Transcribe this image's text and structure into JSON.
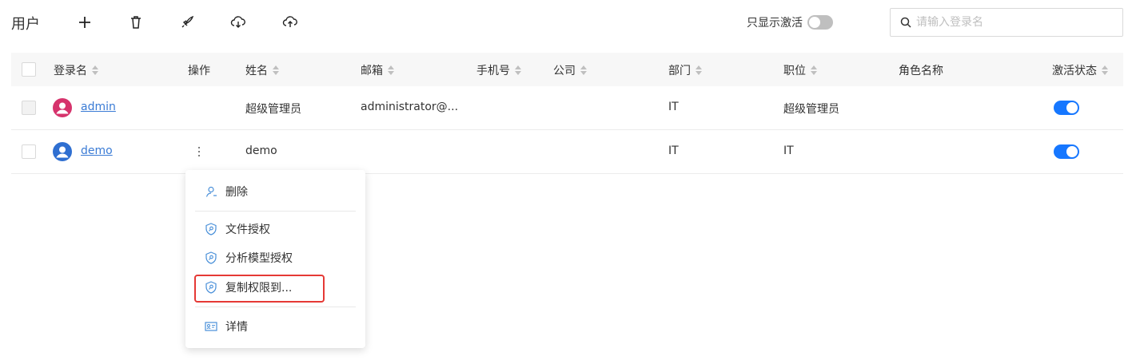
{
  "header": {
    "title": "用户",
    "icons": [
      "add-icon",
      "trash-icon",
      "rocket-icon",
      "cloud-download-icon",
      "cloud-upload-icon"
    ],
    "active_only_label": "只显示激活",
    "active_only_on": false,
    "search_placeholder": "请输入登录名"
  },
  "table": {
    "columns": {
      "login": "登录名",
      "actions": "操作",
      "name": "姓名",
      "email": "邮箱",
      "phone": "手机号",
      "company": "公司",
      "department": "部门",
      "position": "职位",
      "role": "角色名称",
      "status": "激活状态"
    },
    "rows": [
      {
        "login": "admin",
        "name": "超级管理员",
        "email": "administrator@...",
        "phone": "",
        "company": "",
        "department": "IT",
        "position": "超级管理员",
        "role": "",
        "active": true,
        "avatar_color": "#d6336c"
      },
      {
        "login": "demo",
        "name": "demo",
        "email": "",
        "phone": "",
        "company": "",
        "department": "IT",
        "position": "IT",
        "role": "",
        "active": true,
        "avatar_color": "#2f6fd1"
      }
    ]
  },
  "menu": {
    "items": [
      {
        "label": "删除",
        "icon": "user-icon"
      },
      {
        "label": "文件授权",
        "icon": "shield-key-icon"
      },
      {
        "label": "分析模型授权",
        "icon": "shield-key-icon"
      },
      {
        "label": "复制权限到...",
        "icon": "shield-key-icon"
      },
      {
        "label": "详情",
        "icon": "id-card-icon"
      }
    ]
  },
  "colors": {
    "accent": "#1677ff",
    "link": "#3a7bd5",
    "highlight": "#e53935",
    "menu_icon": "#4a90d9"
  }
}
